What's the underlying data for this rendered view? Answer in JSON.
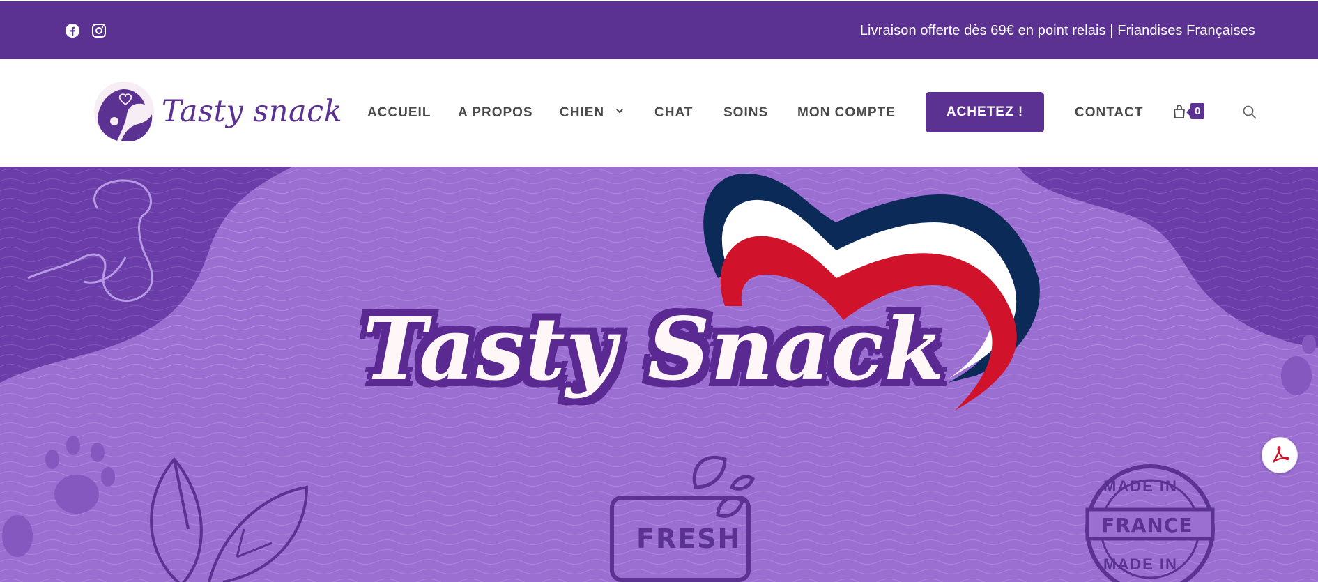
{
  "colors": {
    "brand_purple": "#5b3192",
    "hero_purple": "#9b6fd2",
    "white": "#ffffff",
    "flag_blue": "#0b2a57",
    "flag_red": "#d0132b"
  },
  "topbar": {
    "social": [
      {
        "icon": "facebook-icon"
      },
      {
        "icon": "instagram-icon"
      }
    ],
    "tagline": "Livraison offerte dès 69€ en point relais | Friandises Françaises"
  },
  "header": {
    "logo_text": "Tasty snack",
    "nav": [
      {
        "label": "ACCUEIL"
      },
      {
        "label": "A PROPOS"
      },
      {
        "label": "CHIEN",
        "has_dropdown": true
      },
      {
        "label": "CHAT"
      },
      {
        "label": "SOINS"
      },
      {
        "label": "MON COMPTE"
      },
      {
        "label": "CONTACT"
      }
    ],
    "cta_label": "ACHETEZ !",
    "cart_count": "0"
  },
  "hero": {
    "title": "Tasty Snack",
    "fresh_label": "FRESH",
    "france_label": "FRANCE",
    "made_in_label": "MADE IN"
  }
}
